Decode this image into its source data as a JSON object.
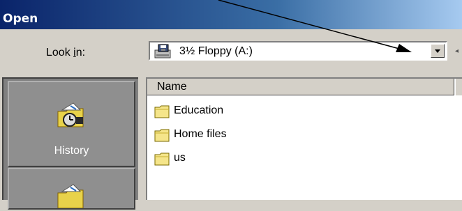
{
  "window": {
    "title": "Open"
  },
  "look_in": {
    "label_before": "Look ",
    "label_accel": "i",
    "label_after": "n:",
    "value": "3½ Floppy (A:)",
    "icon": "floppy-drive-icon"
  },
  "places": [
    {
      "label": "History",
      "icon": "history-icon"
    },
    {
      "label": "",
      "icon": "folder-icon"
    }
  ],
  "file_list": {
    "columns": [
      "Name"
    ],
    "items": [
      {
        "name": "Education",
        "icon": "folder-icon"
      },
      {
        "name": "Home files",
        "icon": "folder-icon"
      },
      {
        "name": "us",
        "icon": "folder-icon"
      }
    ]
  },
  "colors": {
    "title_bar_start": "#0a246a",
    "title_bar_end": "#a6caf0",
    "dialog_face": "#d4d0c8",
    "places_bar": "#808080",
    "folder_yellow": "#f5e58a"
  }
}
